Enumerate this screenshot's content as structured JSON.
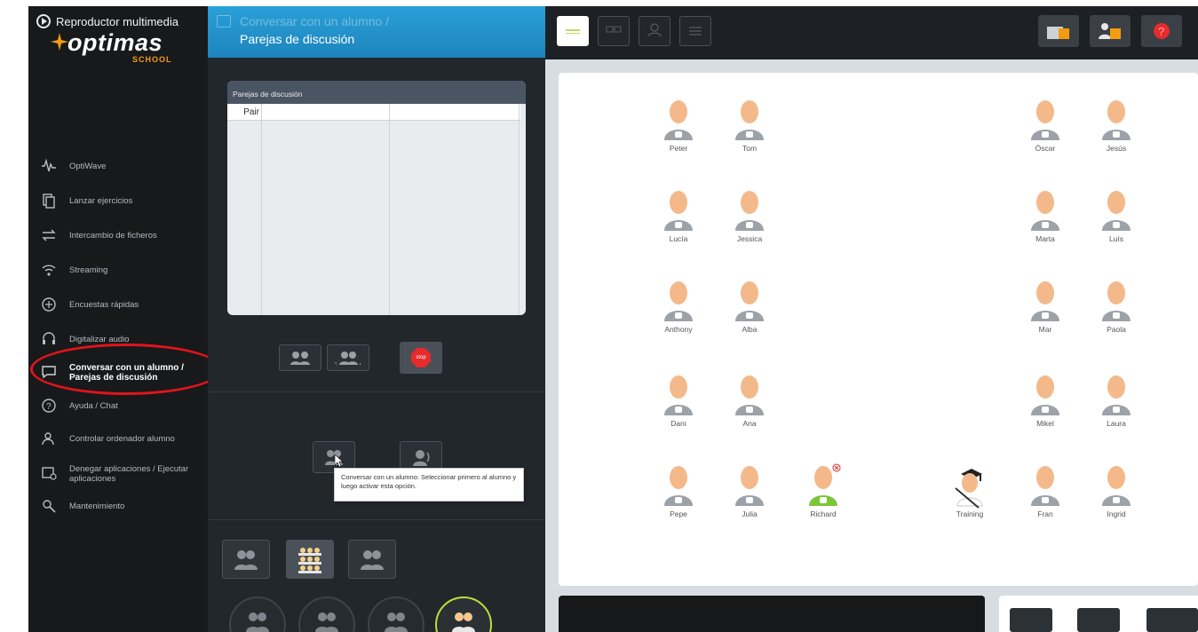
{
  "media_player": {
    "label": "Reproductor multimedia"
  },
  "brand": {
    "name": "optimas",
    "sub": "SCHOOL"
  },
  "nav": [
    {
      "label": "OptiWave",
      "icon": "waveform-icon"
    },
    {
      "label": "Lanzar ejercicios",
      "icon": "pages-icon"
    },
    {
      "label": "Intercambio de ficheros",
      "icon": "exchange-arrows-icon"
    },
    {
      "label": "Streaming",
      "icon": "wifi-icon"
    },
    {
      "label": "Encuestas rápidas",
      "icon": "poll-icon"
    },
    {
      "label": "Digitalizar audio",
      "icon": "headset-icon"
    },
    {
      "label": "Conversar con un alumno / Parejas de discusión",
      "icon": "chat-icon",
      "active": true
    },
    {
      "label": "Ayuda / Chat",
      "icon": "help-icon"
    },
    {
      "label": "Controlar ordenador alumno",
      "icon": "user-screen-icon"
    },
    {
      "label": "Denegar aplicaciones / Ejecutar aplicaciones",
      "icon": "apps-icon"
    },
    {
      "label": "Mantenimiento",
      "icon": "maintenance-icon"
    }
  ],
  "header": {
    "title_line1": "Conversar con un alumno /",
    "title_line2": "Parejas de discusión"
  },
  "pairs": {
    "title": "Parejas de discusión",
    "column_pair": "Pair",
    "rows": []
  },
  "stop_button": {
    "label": "stop"
  },
  "tooltip": {
    "text": "Conversar con un alumno: Seleccionar primero al alumno y luego activar esta opción."
  },
  "students": [
    {
      "name": "Peter"
    },
    {
      "name": "Tom"
    },
    {
      "name": "Óscar"
    },
    {
      "name": "Jesús"
    },
    {
      "name": "Lucía"
    },
    {
      "name": "Jessica"
    },
    {
      "name": "Marta"
    },
    {
      "name": "Luís"
    },
    {
      "name": "Anthony"
    },
    {
      "name": "Alba"
    },
    {
      "name": "Mar"
    },
    {
      "name": "Paola"
    },
    {
      "name": "Dani"
    },
    {
      "name": "Ana"
    },
    {
      "name": "Mikel"
    },
    {
      "name": "Laura"
    },
    {
      "name": "Pepe"
    },
    {
      "name": "Julia"
    },
    {
      "name": "Richard",
      "active": true
    },
    {
      "name": "Training",
      "teacher": true
    },
    {
      "name": "Fran"
    },
    {
      "name": "Ingrid"
    }
  ],
  "colors": {
    "accent": "#2aa0d8",
    "active_student": "#7cc63a",
    "highlight": "#e0141b"
  }
}
